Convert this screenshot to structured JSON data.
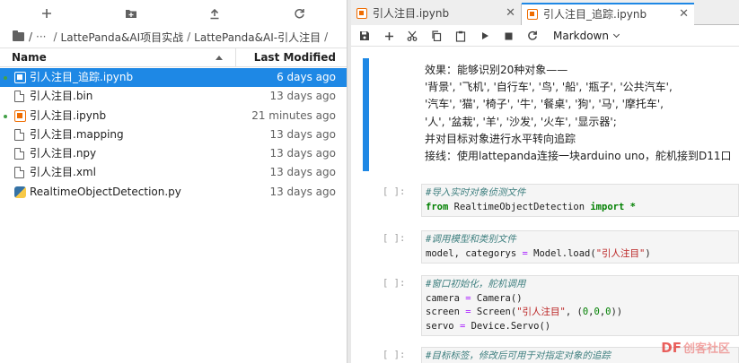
{
  "file_browser": {
    "breadcrumb": [
      "/",
      "···",
      "LattePanda&AI项目实战",
      "LattePanda&AI-引人注目"
    ],
    "header": {
      "name": "Name",
      "modified": "Last Modified"
    },
    "files": [
      {
        "name": "引人注目_追踪.ipynb",
        "modified": "6 days ago",
        "icon": "notebook-icon",
        "running": true,
        "selected": true
      },
      {
        "name": "引人注目.bin",
        "modified": "13 days ago",
        "icon": "file-icon",
        "running": false,
        "selected": false
      },
      {
        "name": "引人注目.ipynb",
        "modified": "21 minutes ago",
        "icon": "notebook-icon",
        "running": true,
        "selected": false
      },
      {
        "name": "引人注目.mapping",
        "modified": "13 days ago",
        "icon": "file-icon",
        "running": false,
        "selected": false
      },
      {
        "name": "引人注目.npy",
        "modified": "13 days ago",
        "icon": "file-icon",
        "running": false,
        "selected": false
      },
      {
        "name": "引人注目.xml",
        "modified": "13 days ago",
        "icon": "file-icon",
        "running": false,
        "selected": false
      },
      {
        "name": "RealtimeObjectDetection.py",
        "modified": "13 days ago",
        "icon": "python-icon",
        "running": false,
        "selected": false
      }
    ]
  },
  "tabs": [
    {
      "label": "引人注目.ipynb",
      "active": false
    },
    {
      "label": "引人注目_追踪.ipynb",
      "active": true
    }
  ],
  "notebook_toolbar": {
    "cell_type": "Markdown"
  },
  "markdown_lines": [
    "效果：能够识别20种对象——",
    "'背景', '飞机', '自行车', '鸟', '船', '瓶子', '公共汽车',",
    "'汽车', '猫', '椅子', '牛', '餐桌', '狗', '马', '摩托车',",
    "'人', '盆栽', '羊', '沙发', '火车', '显示器';",
    "并对目标对象进行水平转向追踪",
    "接线：使用lattepanda连接一块arduino uno，舵机接到D11口"
  ],
  "code_cells": [
    {
      "prompt": "[ ]:",
      "lines": [
        "#导入实时对象侦测文件",
        "from RealtimeObjectDetection import *"
      ]
    },
    {
      "prompt": "[ ]:",
      "lines": [
        "#调用模型和类别文件",
        "model, categorys = Model.load(\"引人注目\")"
      ]
    },
    {
      "prompt": "[ ]:",
      "lines": [
        "#窗口初始化，舵机调用",
        "camera = Camera()",
        "screen = Screen(\"引人注目\", (0,0,0))",
        "servo = Device.Servo()"
      ]
    },
    {
      "prompt": "[ ]:",
      "lines": [
        "#目标标签，修改后可用于对指定对象的追踪"
      ]
    }
  ],
  "watermark": {
    "brand": "DF",
    "sub": "创客社区"
  },
  "colors": {
    "accent": "#1e88e5",
    "notebook": "#ef6c00",
    "running": "#43a047"
  }
}
